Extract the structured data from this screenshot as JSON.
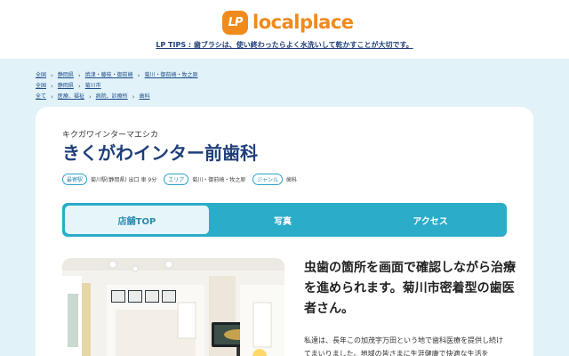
{
  "header": {
    "logo_mark": "LP",
    "logo_text": "localplace",
    "tips": "LP TIPS : 歯ブラシは、使い終わったらよく水洗いして乾かすことが大切です。"
  },
  "breadcrumbs": [
    [
      "全国",
      "静岡県",
      "焼津・藤枝・御前崎",
      "菊川・御前崎・牧之原"
    ],
    [
      "全国",
      "静岡県",
      "菊川市"
    ],
    [
      "全て",
      "医療、福祉",
      "病院、診療所",
      "歯科"
    ]
  ],
  "clinic": {
    "kana": "キクガワインターマエシカ",
    "name": "きくがわインター前歯科",
    "station_tag": "最寄駅",
    "station_value": "菊川駅(静岡県) 出口 車 9分",
    "area_tag": "エリア",
    "area_value": "菊川・御前崎・牧之原",
    "genre_tag": "ジャンル",
    "genre_value": "歯科"
  },
  "tabs": [
    "店舗TOP",
    "写真",
    "アクセス"
  ],
  "description": {
    "headline": "虫歯の箇所を画面で確認しながら治療を進められます。菊川市密着型の歯医者さん。",
    "body": "私達は、長年この加茂字万田という地で歯科医療を提供し続けてまいりました。地域の皆さまに生涯健康で快適な生活を"
  },
  "colors": {
    "brand_orange": "#f08a1c",
    "accent_teal": "#2bacc9",
    "title_navy": "#1f3f7a",
    "page_bg": "#e1f2f8"
  }
}
